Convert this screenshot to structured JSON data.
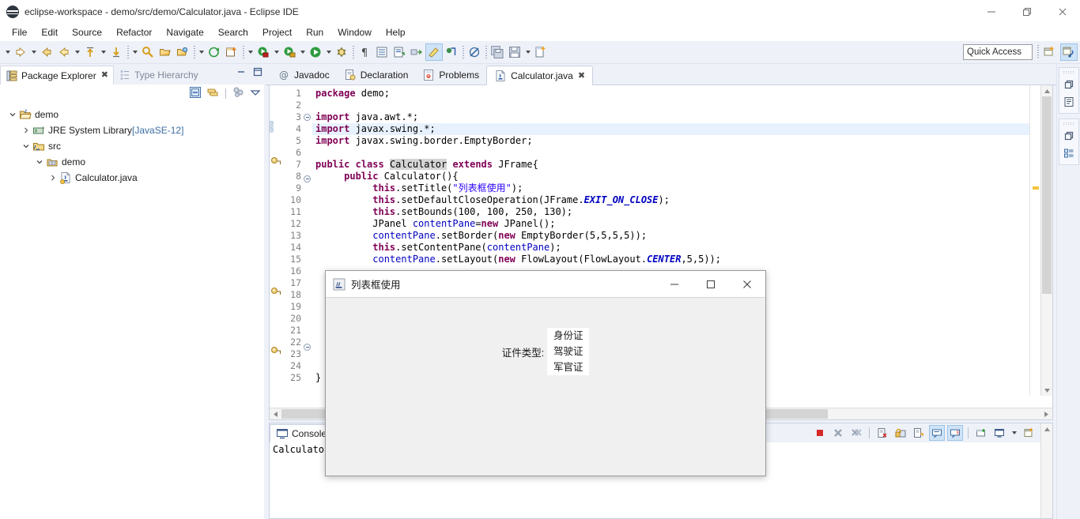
{
  "window": {
    "title": "eclipse-workspace - demo/src/demo/Calculator.java - Eclipse IDE",
    "minimize": "–",
    "restore": "❐",
    "close": "✕"
  },
  "menu": [
    "File",
    "Edit",
    "Source",
    "Refactor",
    "Navigate",
    "Search",
    "Project",
    "Run",
    "Window",
    "Help"
  ],
  "toolbar": {
    "quick_access_placeholder": "Quick Access",
    "items": [
      {
        "name": "new-wizard-icon",
        "kind": "icon"
      },
      {
        "name": "new-wizard-dropdown",
        "kind": "arrow"
      },
      {
        "name": "save-icon",
        "kind": "icon"
      },
      {
        "name": "save-all-icon",
        "kind": "icon"
      },
      {
        "name": "sep",
        "kind": "sep"
      },
      {
        "name": "link-editor-icon",
        "kind": "icon"
      },
      {
        "name": "sep",
        "kind": "sep"
      },
      {
        "name": "skip-all-breakpoints-icon",
        "kind": "icon"
      },
      {
        "name": "open-perspective-highlight-icon",
        "kind": "icon-selected"
      },
      {
        "name": "next-annotation-icon",
        "kind": "icon"
      },
      {
        "name": "build-icon",
        "kind": "icon"
      },
      {
        "name": "toggle-block-selection-icon",
        "kind": "icon"
      },
      {
        "name": "show-whitespace-icon",
        "kind": "icon"
      },
      {
        "name": "sep",
        "kind": "sep"
      },
      {
        "name": "debug-icon",
        "kind": "icon"
      },
      {
        "name": "debug-dropdown",
        "kind": "arrow"
      },
      {
        "name": "run-icon",
        "kind": "icon"
      },
      {
        "name": "run-dropdown",
        "kind": "arrow"
      },
      {
        "name": "run-external-tools-icon",
        "kind": "icon"
      },
      {
        "name": "external-tools-dropdown",
        "kind": "arrow"
      },
      {
        "name": "coverage-icon",
        "kind": "icon"
      },
      {
        "name": "coverage-dropdown",
        "kind": "arrow"
      },
      {
        "name": "sep",
        "kind": "sep"
      },
      {
        "name": "new-java-project-icon",
        "kind": "icon"
      },
      {
        "name": "new-class-icon",
        "kind": "icon"
      },
      {
        "name": "new-class-dropdown",
        "kind": "arrow"
      },
      {
        "name": "sep",
        "kind": "sep"
      },
      {
        "name": "open-type-icon",
        "kind": "icon"
      },
      {
        "name": "open-task-icon",
        "kind": "icon"
      },
      {
        "name": "search-icon",
        "kind": "icon"
      },
      {
        "name": "search-dropdown",
        "kind": "arrow"
      },
      {
        "name": "sep",
        "kind": "sep"
      },
      {
        "name": "next-edit-icon",
        "kind": "icon"
      },
      {
        "name": "next-edit-dropdown",
        "kind": "arrow"
      },
      {
        "name": "previous-edit-icon",
        "kind": "icon"
      },
      {
        "name": "previous-edit-dropdown",
        "kind": "arrow"
      },
      {
        "name": "back-icon",
        "kind": "icon"
      },
      {
        "name": "back-history-icon",
        "kind": "icon"
      },
      {
        "name": "back-dropdown",
        "kind": "arrow"
      },
      {
        "name": "forward-icon",
        "kind": "icon"
      },
      {
        "name": "forward-dropdown",
        "kind": "arrow"
      }
    ]
  },
  "explorer": {
    "tabs": [
      {
        "label": "Package Explorer",
        "active": true,
        "icon": "package-explorer-icon"
      },
      {
        "label": "Type Hierarchy",
        "active": false,
        "icon": "type-hierarchy-icon"
      }
    ],
    "tree": [
      {
        "label": "demo",
        "indent": 0,
        "expanded": true,
        "icon": "java-project-icon",
        "suffix": ""
      },
      {
        "label": "JRE System Library",
        "indent": 1,
        "expanded": false,
        "icon": "jre-library-icon",
        "suffix": " [JavaSE-12]"
      },
      {
        "label": "src",
        "indent": 1,
        "expanded": true,
        "icon": "source-folder-icon",
        "suffix": ""
      },
      {
        "label": "demo",
        "indent": 2,
        "expanded": true,
        "icon": "package-icon",
        "suffix": ""
      },
      {
        "label": "Calculator.java",
        "indent": 3,
        "expanded": false,
        "icon": "java-file-icon",
        "suffix": ""
      }
    ]
  },
  "editor": {
    "tabs": [
      {
        "label": "Javadoc",
        "active": false,
        "icon": "javadoc-icon"
      },
      {
        "label": "Declaration",
        "active": false,
        "icon": "declaration-icon"
      },
      {
        "label": "Problems",
        "active": false,
        "icon": "problems-icon"
      },
      {
        "label": "Calculator.java",
        "active": true,
        "icon": "java-file-icon",
        "closable": true
      }
    ],
    "close_glyph": "✖",
    "lines": [
      {
        "n": 1,
        "fold": "",
        "marker": "",
        "hl": false,
        "html": "<span class=\"kw\">package</span> demo;"
      },
      {
        "n": 2,
        "fold": "",
        "marker": "",
        "hl": false,
        "html": ""
      },
      {
        "n": 3,
        "fold": "minus",
        "marker": "",
        "hl": false,
        "html": "<span class=\"kw\">import</span> java.awt.*;"
      },
      {
        "n": 4,
        "fold": "",
        "marker": "change",
        "hl": true,
        "html": "<span class=\"kw\">import</span> javax.swing.*;"
      },
      {
        "n": 5,
        "fold": "",
        "marker": "",
        "hl": false,
        "html": "<span class=\"kw\">import</span> javax.swing.border.EmptyBorder;"
      },
      {
        "n": 6,
        "fold": "",
        "marker": "",
        "hl": false,
        "html": ""
      },
      {
        "n": 7,
        "fold": "",
        "marker": "warning",
        "hl": false,
        "html": "<span class=\"kw\">public</span> <span class=\"kw\">class</span> <span class=\"cls-hl\">Calculator</span> <span class=\"kw\">extends</span> JFrame{"
      },
      {
        "n": 8,
        "fold": "minus",
        "marker": "",
        "hl": false,
        "html": "     <span class=\"kw\">public</span> Calculator(){"
      },
      {
        "n": 9,
        "fold": "",
        "marker": "",
        "hl": false,
        "html": "          <span class=\"kw\">this</span>.setTitle(<span class=\"str\">\"列表框使用\"</span>);"
      },
      {
        "n": 10,
        "fold": "",
        "marker": "",
        "hl": false,
        "html": "          <span class=\"kw\">this</span>.setDefaultCloseOperation(JFrame.<span class=\"stat\">EXIT_ON_CLOSE</span>);"
      },
      {
        "n": 11,
        "fold": "",
        "marker": "",
        "hl": false,
        "html": "          <span class=\"kw\">this</span>.setBounds(100, 100, 250, 130);"
      },
      {
        "n": 12,
        "fold": "",
        "marker": "",
        "hl": false,
        "html": "          JPanel <span class=\"fld\">contentPane</span>=<span class=\"kw\">new</span> JPanel();"
      },
      {
        "n": 13,
        "fold": "",
        "marker": "",
        "hl": false,
        "html": "          <span class=\"fld\">contentPane</span>.setBorder(<span class=\"kw\">new</span> EmptyBorder(5,5,5,5));"
      },
      {
        "n": 14,
        "fold": "",
        "marker": "",
        "hl": false,
        "html": "          <span class=\"kw\">this</span>.setContentPane(<span class=\"fld\">contentPane</span>);"
      },
      {
        "n": 15,
        "fold": "",
        "marker": "",
        "hl": false,
        "html": "          <span class=\"fld\">contentPane</span>.setLayout(<span class=\"kw\">new</span> FlowLayout(FlowLayout.<span class=\"stat\">CENTER</span>,5,5));"
      },
      {
        "n": 16,
        "fold": "",
        "marker": "",
        "hl": false,
        "html": ""
      },
      {
        "n": 17,
        "fold": "",
        "marker": "",
        "hl": false,
        "html": ""
      },
      {
        "n": 18,
        "fold": "",
        "marker": "warning",
        "hl": false,
        "html": ""
      },
      {
        "n": 19,
        "fold": "",
        "marker": "",
        "hl": false,
        "html": ""
      },
      {
        "n": 20,
        "fold": "",
        "marker": "",
        "hl": false,
        "html": ""
      },
      {
        "n": 21,
        "fold": "",
        "marker": "",
        "hl": false,
        "html": ""
      },
      {
        "n": 22,
        "fold": "minus",
        "marker": "",
        "hl": false,
        "html": ""
      },
      {
        "n": 23,
        "fold": "",
        "marker": "warning",
        "hl": false,
        "html": ""
      },
      {
        "n": 24,
        "fold": "",
        "marker": "",
        "hl": false,
        "html": ""
      },
      {
        "n": 25,
        "fold": "",
        "marker": "",
        "hl": false,
        "html": "}"
      }
    ]
  },
  "console": {
    "tab_label": "Console",
    "output": "Calculator [Java Application]"
  },
  "dialog": {
    "title": "列表框使用",
    "icon": "java-coffee-cup-icon",
    "minimize": "–",
    "maximize": "□",
    "close": "✕",
    "field_label": "证件类型:",
    "list_items": [
      "身份证",
      "驾驶证",
      "军官证"
    ]
  },
  "colors": {
    "chrome": "#eef1f8",
    "accent_selected": "#cfe3f7",
    "keyword": "#7f0055",
    "string": "#2a00ff",
    "field": "#0000c0",
    "line_highlight": "#e8f2fe",
    "dialog_bg": "#f0f0f0"
  }
}
